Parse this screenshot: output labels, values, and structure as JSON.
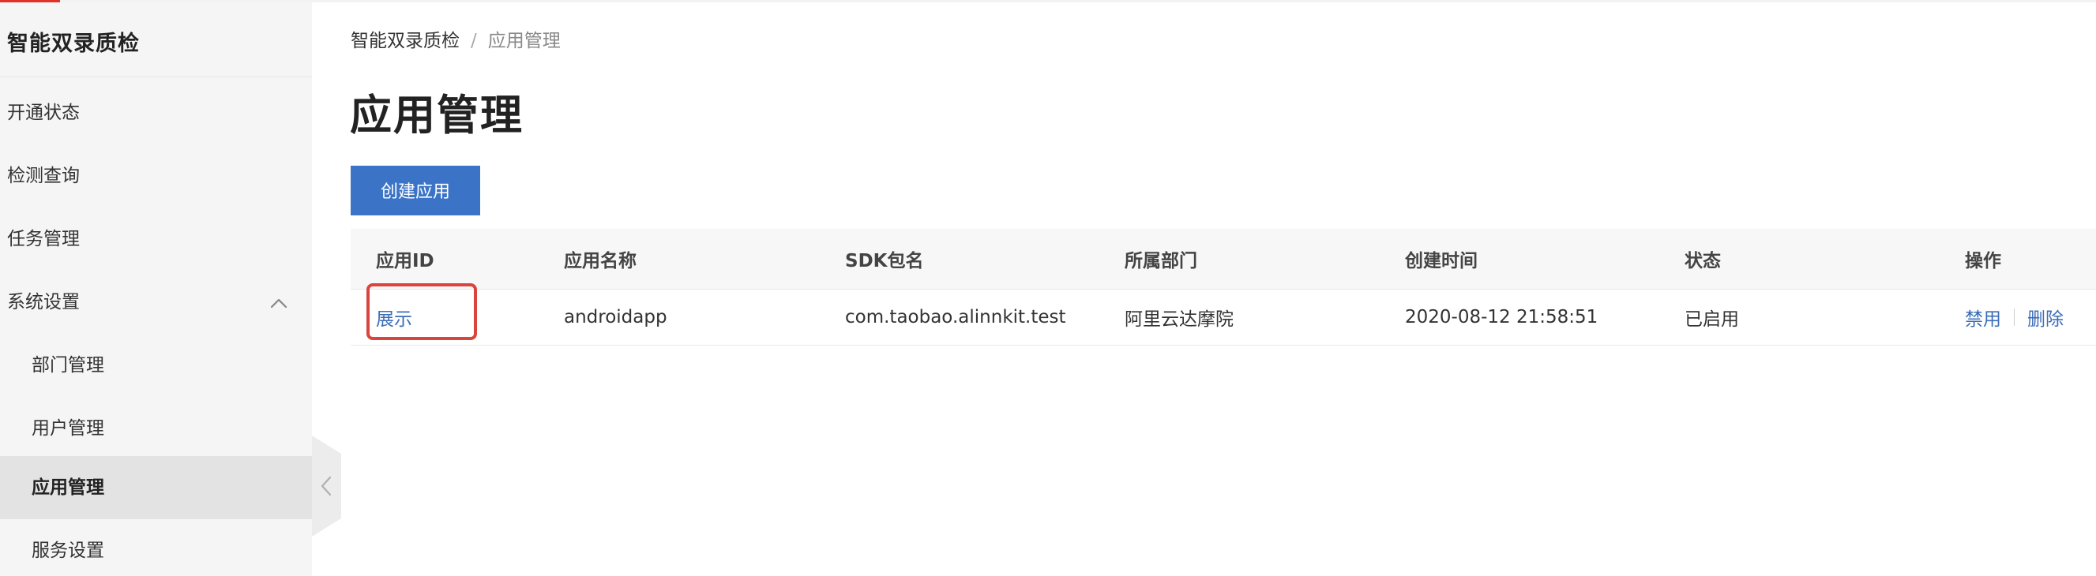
{
  "sidebar": {
    "title": "智能双录质检",
    "items": [
      {
        "label": "开通状态"
      },
      {
        "label": "检测查询"
      },
      {
        "label": "任务管理"
      },
      {
        "label": "系统设置"
      },
      {
        "label": "部门管理"
      },
      {
        "label": "用户管理"
      },
      {
        "label": "应用管理"
      },
      {
        "label": "服务设置"
      }
    ],
    "active_item": "应用管理"
  },
  "breadcrumb": {
    "root": "智能双录质检",
    "separator": "/",
    "current": "应用管理"
  },
  "page": {
    "title": "应用管理",
    "create_button": "创建应用"
  },
  "table": {
    "columns": [
      "应用ID",
      "应用名称",
      "SDK包名",
      "所属部门",
      "创建时间",
      "状态",
      "操作"
    ],
    "rows": [
      {
        "app_id": "展示",
        "app_name": "androidapp",
        "sdk_package": "com.taobao.alinnkit.test",
        "department": "阿里云达摩院",
        "created_at": "2020-08-12 21:58:51",
        "status": "已启用",
        "actions": {
          "disable": "禁用",
          "delete": "删除"
        }
      }
    ]
  },
  "colors": {
    "accent": "#3b74c6",
    "link": "#3b6db8",
    "highlight": "#d9443c",
    "brand_red": "#e0312b"
  },
  "icons": {
    "submenu_toggle": "chevron-up-icon",
    "sidebar_collapse": "chevron-left-icon"
  }
}
